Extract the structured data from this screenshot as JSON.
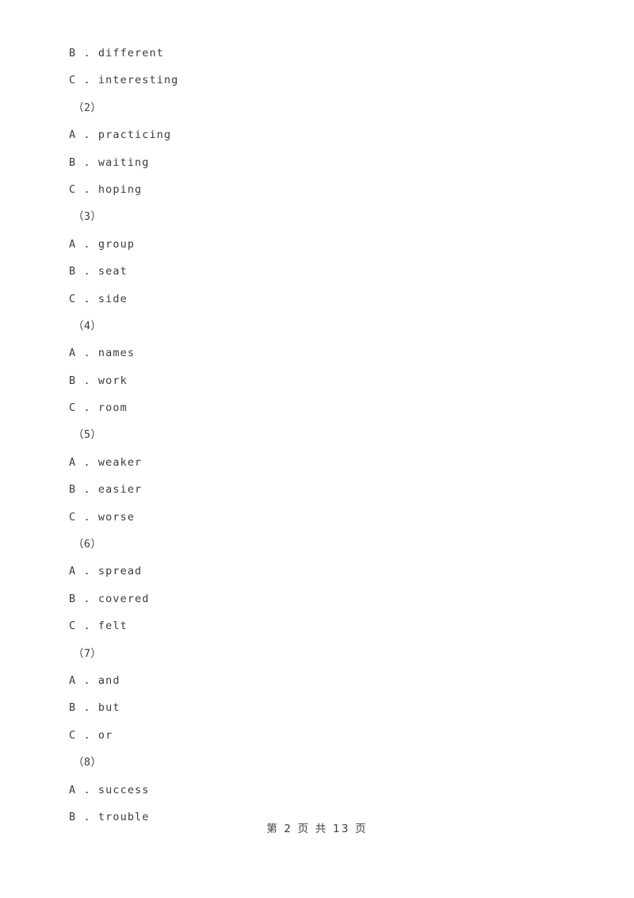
{
  "document": {
    "page_background": "#ffffff",
    "text_color": "#3c3c3c",
    "lines": [
      {
        "kind": "option",
        "text": "B . different"
      },
      {
        "kind": "option",
        "text": "C . interesting"
      },
      {
        "kind": "qnum",
        "text": "（2）"
      },
      {
        "kind": "option",
        "text": "A . practicing"
      },
      {
        "kind": "option",
        "text": "B . waiting"
      },
      {
        "kind": "option",
        "text": "C . hoping"
      },
      {
        "kind": "qnum",
        "text": "（3）"
      },
      {
        "kind": "option",
        "text": "A . group"
      },
      {
        "kind": "option",
        "text": "B . seat"
      },
      {
        "kind": "option",
        "text": "C . side"
      },
      {
        "kind": "qnum",
        "text": "（4）"
      },
      {
        "kind": "option",
        "text": "A . names"
      },
      {
        "kind": "option",
        "text": "B . work"
      },
      {
        "kind": "option",
        "text": "C . room"
      },
      {
        "kind": "qnum",
        "text": "（5）"
      },
      {
        "kind": "option",
        "text": "A . weaker"
      },
      {
        "kind": "option",
        "text": "B . easier"
      },
      {
        "kind": "option",
        "text": "C . worse"
      },
      {
        "kind": "qnum",
        "text": "（6）"
      },
      {
        "kind": "option",
        "text": "A . spread"
      },
      {
        "kind": "option",
        "text": "B . covered"
      },
      {
        "kind": "option",
        "text": "C . felt"
      },
      {
        "kind": "qnum",
        "text": "（7）"
      },
      {
        "kind": "option",
        "text": "A . and"
      },
      {
        "kind": "option",
        "text": "B . but"
      },
      {
        "kind": "option",
        "text": "C . or"
      },
      {
        "kind": "qnum",
        "text": "（8）"
      },
      {
        "kind": "option",
        "text": "A . success"
      },
      {
        "kind": "option",
        "text": "B . trouble"
      }
    ],
    "footer": {
      "text": "第 2 页 共 13 页",
      "page_number": "2",
      "total_pages": "13"
    }
  }
}
